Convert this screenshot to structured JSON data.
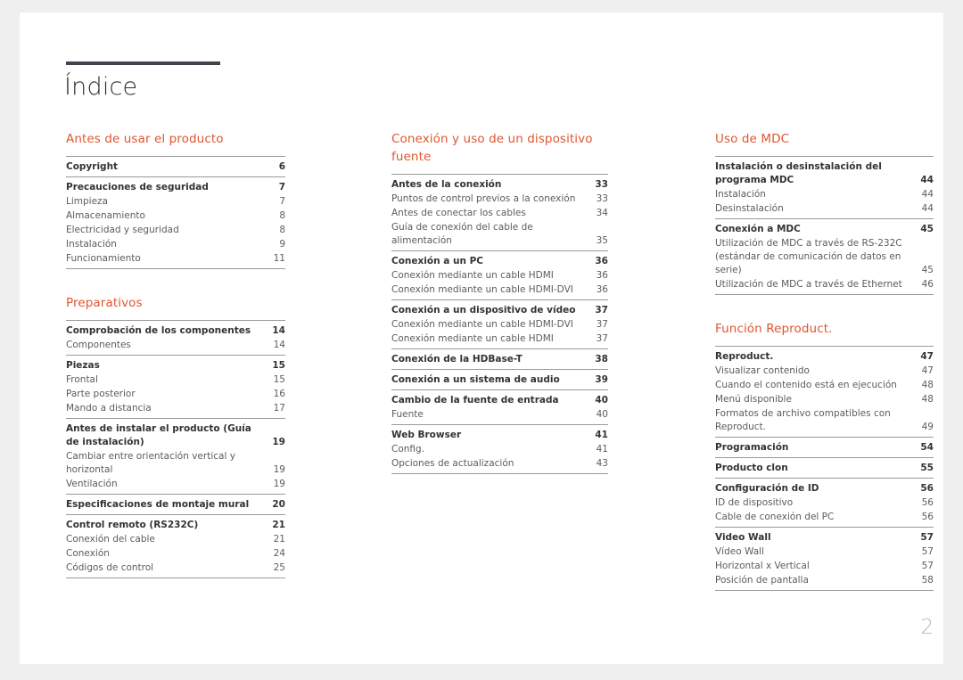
{
  "document": {
    "title": "Índice",
    "folio": "2",
    "accent_color": "#e0562f",
    "rule_color": "#45424f"
  },
  "columns": [
    {
      "name": "column-1",
      "sections": [
        {
          "heading": "Antes de usar el producto",
          "groups": [
            {
              "entries": [
                {
                  "label": "Copyright",
                  "page": "6",
                  "level": "main"
                }
              ]
            },
            {
              "entries": [
                {
                  "label": "Precauciones de seguridad",
                  "page": "7",
                  "level": "main"
                },
                {
                  "label": "Limpieza",
                  "page": "7",
                  "level": "sub"
                },
                {
                  "label": "Almacenamiento",
                  "page": "8",
                  "level": "sub"
                },
                {
                  "label": "Electricidad y seguridad",
                  "page": "8",
                  "level": "sub"
                },
                {
                  "label": "Instalación",
                  "page": "9",
                  "level": "sub"
                },
                {
                  "label": "Funcionamiento",
                  "page": "11",
                  "level": "sub"
                }
              ]
            }
          ]
        },
        {
          "heading": "Preparativos",
          "groups": [
            {
              "entries": [
                {
                  "label": "Comprobación de los componentes",
                  "page": "14",
                  "level": "main"
                },
                {
                  "label": "Componentes",
                  "page": "14",
                  "level": "sub"
                }
              ]
            },
            {
              "entries": [
                {
                  "label": "Piezas",
                  "page": "15",
                  "level": "main"
                },
                {
                  "label": "Frontal",
                  "page": "15",
                  "level": "sub"
                },
                {
                  "label": "Parte posterior",
                  "page": "16",
                  "level": "sub"
                },
                {
                  "label": "Mando a distancia",
                  "page": "17",
                  "level": "sub"
                }
              ]
            },
            {
              "entries": [
                {
                  "label": "Antes de instalar el producto (Guía de instalación)",
                  "page": "19",
                  "level": "main"
                },
                {
                  "label": "Cambiar entre orientación vertical y horizontal",
                  "page": "19",
                  "level": "sub"
                },
                {
                  "label": "Ventilación",
                  "page": "19",
                  "level": "sub"
                }
              ]
            },
            {
              "entries": [
                {
                  "label": "Especificaciones de montaje mural",
                  "page": "20",
                  "level": "main"
                }
              ]
            },
            {
              "entries": [
                {
                  "label": "Control remoto (RS232C)",
                  "page": "21",
                  "level": "main"
                },
                {
                  "label": "Conexión del cable",
                  "page": "21",
                  "level": "sub"
                },
                {
                  "label": "Conexión",
                  "page": "24",
                  "level": "sub"
                },
                {
                  "label": "Códigos de control",
                  "page": "25",
                  "level": "sub"
                }
              ]
            }
          ]
        }
      ]
    },
    {
      "name": "column-2",
      "sections": [
        {
          "heading": "Conexión y uso de un dispositivo fuente",
          "groups": [
            {
              "entries": [
                {
                  "label": "Antes de la conexión",
                  "page": "33",
                  "level": "main"
                },
                {
                  "label": "Puntos de control previos a la conexión",
                  "page": "33",
                  "level": "sub"
                },
                {
                  "label": "Antes de conectar los cables",
                  "page": "34",
                  "level": "sub"
                },
                {
                  "label": "Guía de conexión del cable de alimentación",
                  "page": "35",
                  "level": "sub"
                }
              ]
            },
            {
              "entries": [
                {
                  "label": "Conexión a un PC",
                  "page": "36",
                  "level": "main"
                },
                {
                  "label": "Conexión mediante un cable HDMI",
                  "page": "36",
                  "level": "sub"
                },
                {
                  "label": "Conexión mediante un cable HDMI-DVI",
                  "page": "36",
                  "level": "sub"
                }
              ]
            },
            {
              "entries": [
                {
                  "label": "Conexión a un dispositivo de vídeo",
                  "page": "37",
                  "level": "main"
                },
                {
                  "label": "Conexión mediante un cable HDMI-DVI",
                  "page": "37",
                  "level": "sub"
                },
                {
                  "label": "Conexión mediante un cable HDMI",
                  "page": "37",
                  "level": "sub"
                }
              ]
            },
            {
              "entries": [
                {
                  "label": "Conexión de la HDBase-T",
                  "page": "38",
                  "level": "main"
                }
              ]
            },
            {
              "entries": [
                {
                  "label": "Conexión a un sistema de audio",
                  "page": "39",
                  "level": "main"
                }
              ]
            },
            {
              "entries": [
                {
                  "label": "Cambio de la fuente de entrada",
                  "page": "40",
                  "level": "main"
                },
                {
                  "label": "Fuente",
                  "page": "40",
                  "level": "sub"
                }
              ]
            },
            {
              "entries": [
                {
                  "label": "Web Browser",
                  "page": "41",
                  "level": "main"
                },
                {
                  "label": "Config.",
                  "page": "41",
                  "level": "sub"
                },
                {
                  "label": "Opciones de actualización",
                  "page": "43",
                  "level": "sub"
                }
              ]
            }
          ]
        }
      ]
    },
    {
      "name": "column-3",
      "sections": [
        {
          "heading": "Uso de MDC",
          "groups": [
            {
              "entries": [
                {
                  "label": "Instalación o desinstalación del programa MDC",
                  "page": "44",
                  "level": "main"
                },
                {
                  "label": "Instalación",
                  "page": "44",
                  "level": "sub"
                },
                {
                  "label": "Desinstalación",
                  "page": "44",
                  "level": "sub"
                }
              ]
            },
            {
              "entries": [
                {
                  "label": "Conexión a MDC",
                  "page": "45",
                  "level": "main"
                },
                {
                  "label": "Utilización de MDC a través de RS-232C (estándar de comunicación de datos en serie)",
                  "page": "45",
                  "level": "sub"
                },
                {
                  "label": "Utilización de MDC a través de Ethernet",
                  "page": "46",
                  "level": "sub"
                }
              ]
            }
          ]
        },
        {
          "heading": "Función Reproduct.",
          "groups": [
            {
              "entries": [
                {
                  "label": "Reproduct.",
                  "page": "47",
                  "level": "main"
                },
                {
                  "label": "Visualizar contenido",
                  "page": "47",
                  "level": "sub"
                },
                {
                  "label": "Cuando el contenido está en ejecución",
                  "page": "48",
                  "level": "sub"
                },
                {
                  "label": "Menú disponible",
                  "page": "48",
                  "level": "sub"
                },
                {
                  "label": "Formatos de archivo compatibles con Reproduct.",
                  "page": "49",
                  "level": "sub"
                }
              ]
            },
            {
              "entries": [
                {
                  "label": "Programación",
                  "page": "54",
                  "level": "main"
                }
              ]
            },
            {
              "entries": [
                {
                  "label": "Producto clon",
                  "page": "55",
                  "level": "main"
                }
              ]
            },
            {
              "entries": [
                {
                  "label": "Configuración de ID",
                  "page": "56",
                  "level": "main"
                },
                {
                  "label": "ID de dispositivo",
                  "page": "56",
                  "level": "sub"
                },
                {
                  "label": "Cable de conexión del PC",
                  "page": "56",
                  "level": "sub"
                }
              ]
            },
            {
              "entries": [
                {
                  "label": "Video Wall",
                  "page": "57",
                  "level": "main"
                },
                {
                  "label": "Vídeo Wall",
                  "page": "57",
                  "level": "sub"
                },
                {
                  "label": "Horizontal x Vertical",
                  "page": "57",
                  "level": "sub"
                },
                {
                  "label": "Posición de pantalla",
                  "page": "58",
                  "level": "sub"
                }
              ]
            }
          ]
        }
      ]
    }
  ]
}
